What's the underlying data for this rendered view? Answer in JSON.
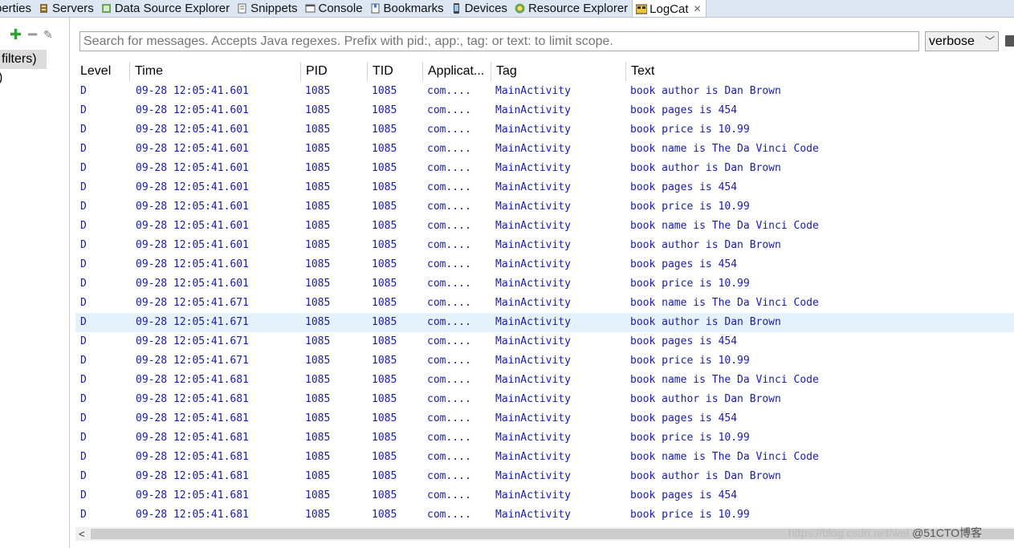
{
  "tabs": [
    {
      "label": "perties",
      "icon": "properties-icon"
    },
    {
      "label": "Servers",
      "icon": "servers-icon"
    },
    {
      "label": "Data Source Explorer",
      "icon": "data-source-icon"
    },
    {
      "label": "Snippets",
      "icon": "snippets-icon"
    },
    {
      "label": "Console",
      "icon": "console-icon"
    },
    {
      "label": "Bookmarks",
      "icon": "bookmarks-icon"
    },
    {
      "label": "Devices",
      "icon": "devices-icon"
    },
    {
      "label": "Resource Explorer",
      "icon": "resource-explorer-icon"
    },
    {
      "label": "LogCat",
      "icon": "logcat-icon",
      "active": true
    }
  ],
  "left_panel": {
    "selected_filter": "filters)",
    "second_item": ")"
  },
  "search": {
    "placeholder": "Search for messages. Accepts Java regexes. Prefix with pid:, app:, tag: or text: to limit scope."
  },
  "log_level": {
    "selected": "verbose"
  },
  "columns": [
    "Level",
    "Time",
    "PID",
    "TID",
    "Applicat...",
    "Tag",
    "Text"
  ],
  "rows": [
    [
      "D",
      "09-28 12:05:41.601",
      "1085",
      "1085",
      "com....",
      "MainActivity",
      "book author is Dan Brown"
    ],
    [
      "D",
      "09-28 12:05:41.601",
      "1085",
      "1085",
      "com....",
      "MainActivity",
      "book pages is 454"
    ],
    [
      "D",
      "09-28 12:05:41.601",
      "1085",
      "1085",
      "com....",
      "MainActivity",
      "book price is 10.99"
    ],
    [
      "D",
      "09-28 12:05:41.601",
      "1085",
      "1085",
      "com....",
      "MainActivity",
      "book name is The Da Vinci Code"
    ],
    [
      "D",
      "09-28 12:05:41.601",
      "1085",
      "1085",
      "com....",
      "MainActivity",
      "book author is Dan Brown"
    ],
    [
      "D",
      "09-28 12:05:41.601",
      "1085",
      "1085",
      "com....",
      "MainActivity",
      "book pages is 454"
    ],
    [
      "D",
      "09-28 12:05:41.601",
      "1085",
      "1085",
      "com....",
      "MainActivity",
      "book price is 10.99"
    ],
    [
      "D",
      "09-28 12:05:41.601",
      "1085",
      "1085",
      "com....",
      "MainActivity",
      "book name is The Da Vinci Code"
    ],
    [
      "D",
      "09-28 12:05:41.601",
      "1085",
      "1085",
      "com....",
      "MainActivity",
      "book author is Dan Brown"
    ],
    [
      "D",
      "09-28 12:05:41.601",
      "1085",
      "1085",
      "com....",
      "MainActivity",
      "book pages is 454"
    ],
    [
      "D",
      "09-28 12:05:41.601",
      "1085",
      "1085",
      "com....",
      "MainActivity",
      "book price is 10.99"
    ],
    [
      "D",
      "09-28 12:05:41.671",
      "1085",
      "1085",
      "com....",
      "MainActivity",
      "book name is The Da Vinci Code"
    ],
    [
      "D",
      "09-28 12:05:41.671",
      "1085",
      "1085",
      "com....",
      "MainActivity",
      "book author is Dan Brown"
    ],
    [
      "D",
      "09-28 12:05:41.671",
      "1085",
      "1085",
      "com....",
      "MainActivity",
      "book pages is 454"
    ],
    [
      "D",
      "09-28 12:05:41.671",
      "1085",
      "1085",
      "com....",
      "MainActivity",
      "book price is 10.99"
    ],
    [
      "D",
      "09-28 12:05:41.681",
      "1085",
      "1085",
      "com....",
      "MainActivity",
      "book name is The Da Vinci Code"
    ],
    [
      "D",
      "09-28 12:05:41.681",
      "1085",
      "1085",
      "com....",
      "MainActivity",
      "book author is Dan Brown"
    ],
    [
      "D",
      "09-28 12:05:41.681",
      "1085",
      "1085",
      "com....",
      "MainActivity",
      "book pages is 454"
    ],
    [
      "D",
      "09-28 12:05:41.681",
      "1085",
      "1085",
      "com....",
      "MainActivity",
      "book price is 10.99"
    ],
    [
      "D",
      "09-28 12:05:41.681",
      "1085",
      "1085",
      "com....",
      "MainActivity",
      "book name is The Da Vinci Code"
    ],
    [
      "D",
      "09-28 12:05:41.681",
      "1085",
      "1085",
      "com....",
      "MainActivity",
      "book author is Dan Brown"
    ],
    [
      "D",
      "09-28 12:05:41.681",
      "1085",
      "1085",
      "com....",
      "MainActivity",
      "book pages is 454"
    ],
    [
      "D",
      "09-28 12:05:41.681",
      "1085",
      "1085",
      "com....",
      "MainActivity",
      "book price is 10.99"
    ]
  ],
  "highlighted_row": 12,
  "watermark": {
    "url": "https://blog.csdn.net/wei",
    "brand": "@51CTO博客"
  },
  "colors": {
    "log_text": "#1b1ba6",
    "tabbar_bg": "#dde6f3",
    "highlight_row": "#e6f2fb"
  }
}
